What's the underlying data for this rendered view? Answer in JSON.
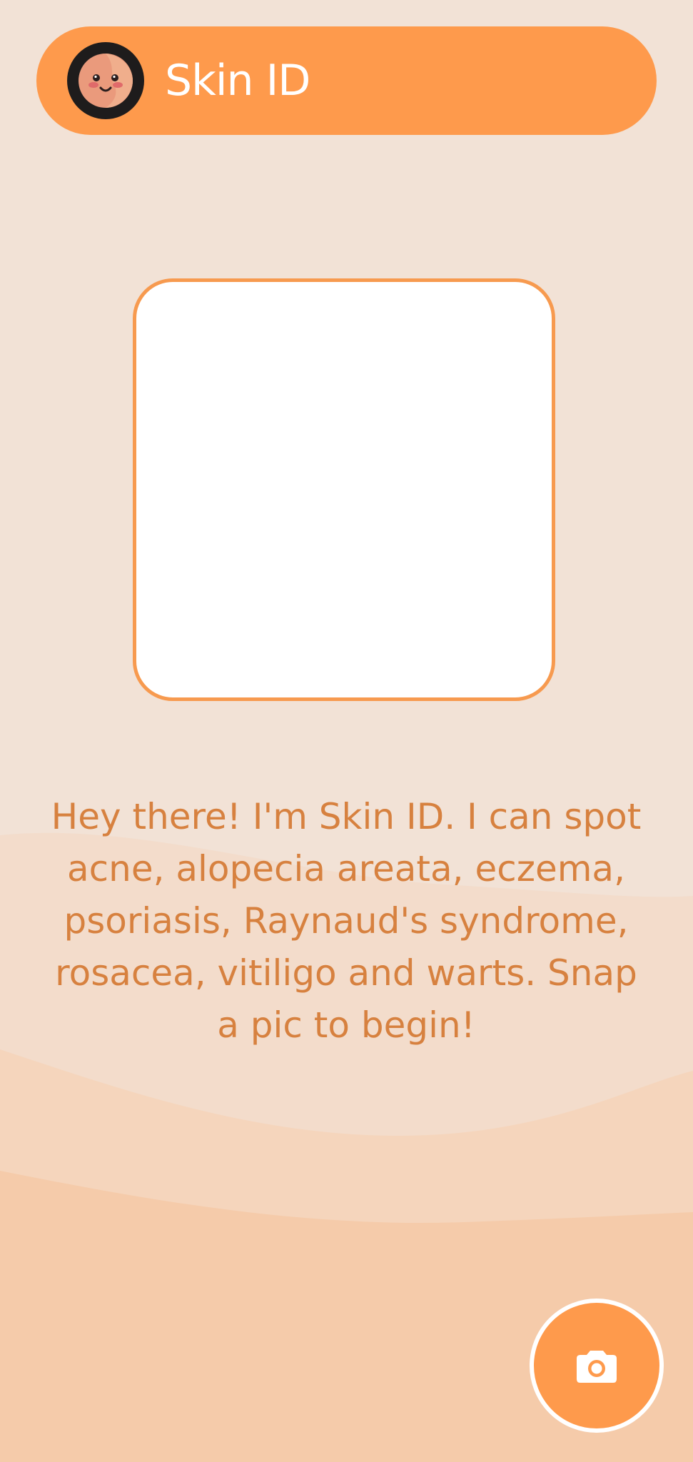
{
  "header": {
    "title": "Skin ID",
    "avatar_icon": "smiling-face-icon"
  },
  "preview": {
    "state": "empty"
  },
  "intro": {
    "text": "Hey there! I'm Skin ID. I can spot acne, alopecia areata, eczema, psoriasis, Raynaud's syndrome, rosacea, vitiligo and warts. Snap a pic to begin!"
  },
  "actions": {
    "camera_icon": "camera-icon"
  },
  "colors": {
    "background": "#F2E2D6",
    "accent": "#FE9A4C",
    "text": "#D7813F",
    "frame_border": "#F79A4F"
  }
}
